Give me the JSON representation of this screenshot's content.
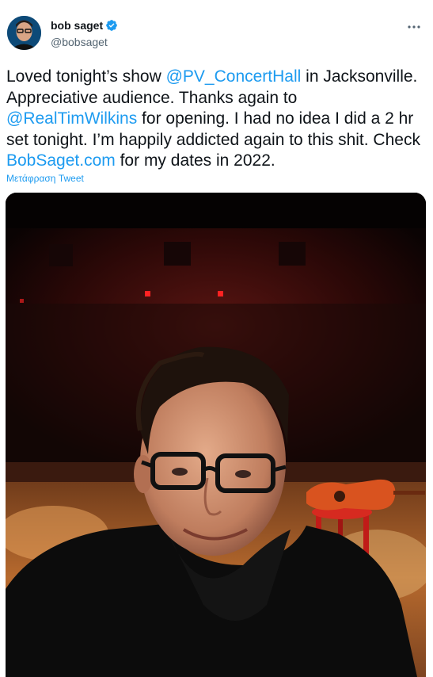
{
  "author": {
    "display_name": "bob saget",
    "handle": "@bobsaget"
  },
  "tweet": {
    "seg1": "Loved tonight’s show ",
    "mention1": "@PV_ConcertHall",
    "seg2": " in Jacksonville. Appreciative audience. Thanks again to ",
    "mention2": "@RealTimWilkins",
    "seg3": " for opening. I had no idea I did a 2 hr set tonight. I’m happily addicted again to this shit. Check ",
    "link": "BobSaget.com",
    "seg4": " for my dates in 2022."
  },
  "translate_label": "Μετάφραση Tweet",
  "icons": {
    "verified": "verified-badge-icon",
    "more": "more-options-icon"
  },
  "colors": {
    "link": "#1d9bf0",
    "secondary_text": "#536471",
    "primary_text": "#0f1419"
  }
}
